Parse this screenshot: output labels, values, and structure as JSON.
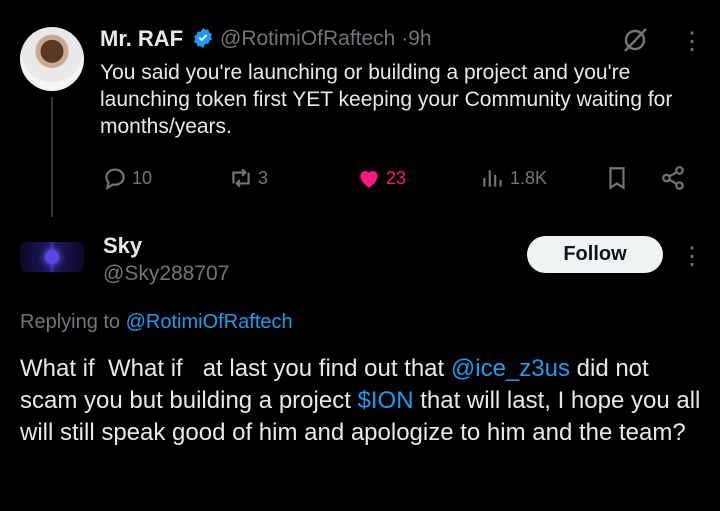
{
  "tweet": {
    "author_name": "Mr. RAF",
    "handle": "@RotimiOfRaftech",
    "time_sep": "·",
    "time": "9h",
    "text": "You said you're launching or building a project and you're launching token first YET keeping your Community waiting for months/years.",
    "replies": "10",
    "retweets": "3",
    "likes": "23",
    "views": "1.8K"
  },
  "reply": {
    "author_name": "Sky",
    "handle": "@Sky288707",
    "follow_label": "Follow",
    "replying_prefix": "Replying to",
    "replying_handle": "@RotimiOfRaftech",
    "body_part1": "What if  What if   at last you find out that ",
    "mention": "@ice_z3us",
    "body_part2": " did not scam you but building a project ",
    "cashtag": "$ION",
    "body_part3": " that will last, I hope you all will still speak good of him and apologize to him and the team?"
  },
  "colors": {
    "background": "#000000",
    "text": "#e7e9ea",
    "muted": "#71767b",
    "link": "#1d9bf0",
    "like": "#f91880",
    "verified": "#1d9bf0"
  },
  "icons": [
    "verified-badge-icon",
    "grok-icon",
    "more-icon",
    "reply-icon",
    "retweet-icon",
    "like-icon",
    "views-icon",
    "bookmark-icon",
    "share-icon"
  ]
}
